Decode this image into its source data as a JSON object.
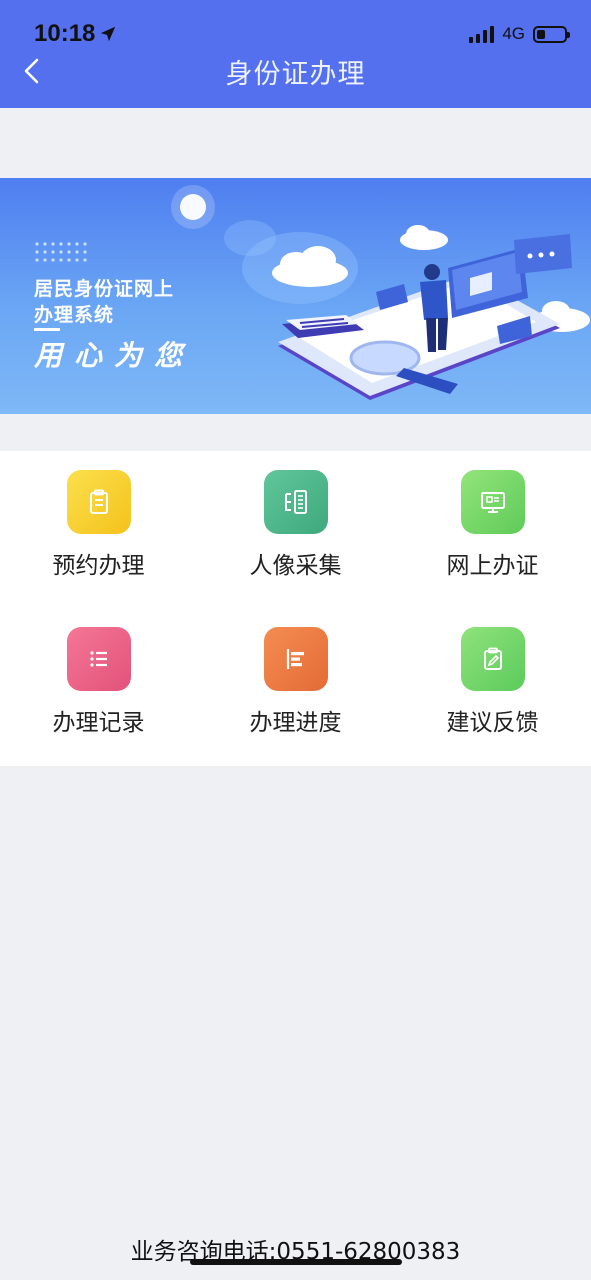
{
  "status_bar": {
    "time": "10:18",
    "network": "4G",
    "battery_level": 0.3
  },
  "nav": {
    "title": "身份证办理"
  },
  "banner": {
    "line1": "居民身份证网上",
    "line2": "办理系统",
    "slogan": "用心为您"
  },
  "menu": {
    "items": [
      {
        "label": "预约办理",
        "icon": "clipboard-icon",
        "color": "#f7cf2e"
      },
      {
        "label": "人像采集",
        "icon": "scan-icon",
        "color": "#4fb98e"
      },
      {
        "label": "网上办证",
        "icon": "monitor-icon",
        "color": "#7dd96a"
      },
      {
        "label": "办理记录",
        "icon": "list-icon",
        "color": "#ec6585"
      },
      {
        "label": "办理进度",
        "icon": "progress-icon",
        "color": "#ee7f46"
      },
      {
        "label": "建议反馈",
        "icon": "feedback-icon",
        "color": "#74d869"
      }
    ]
  },
  "footer": {
    "hotline": "业务咨询电话:0551-62800383"
  },
  "colors": {
    "header_bg": "#5470ee",
    "page_bg": "#eef0f4"
  }
}
